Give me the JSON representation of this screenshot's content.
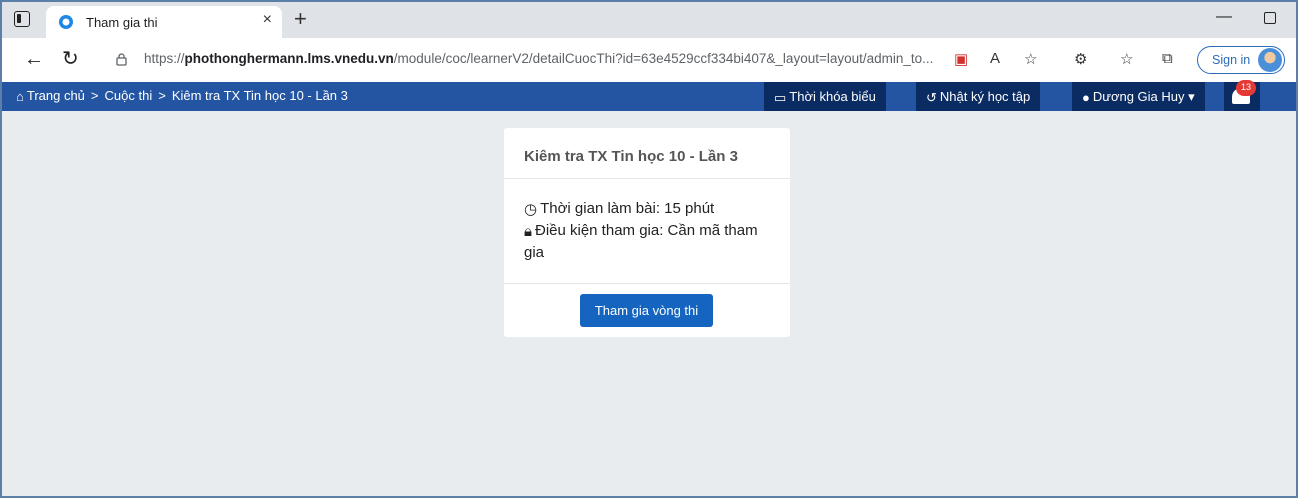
{
  "browser": {
    "tab_title": "Tham gia thi",
    "tab_close": "×",
    "new_tab": "+",
    "url_prefix": "https://",
    "url_host": "phothonghermann.lms.vnedu.vn",
    "url_path": "/module/coc/learnerV2/detailCuocThi?id=63e4529ccf334bi407&_layout=layout/admin_to...",
    "sign_in": "Sign in",
    "minimize": "—"
  },
  "navbar": {
    "breadcrumbs": [
      "Trang chủ",
      "Cuộc thi",
      "Kiêm tra TX Tin học 10 - Lần 3"
    ],
    "separator": ">",
    "timetable": "Thời khóa biểu",
    "learning_log": "Nhật ký học tập",
    "user": "Dương Gia Huy",
    "notification_count": "13"
  },
  "card": {
    "title": "Kiêm tra TX Tin học 10 - Lần 3",
    "duration": "Thời gian làm bài: 15 phút",
    "condition": "Điều kiện tham gia: Cần mã tham gia",
    "join_button": "Tham gia vòng thi"
  },
  "colors": {
    "navbar": "#2355a3",
    "navbar_button": "#0b2c63",
    "primary_button": "#1565c0",
    "page_background": "#e9ecef"
  }
}
